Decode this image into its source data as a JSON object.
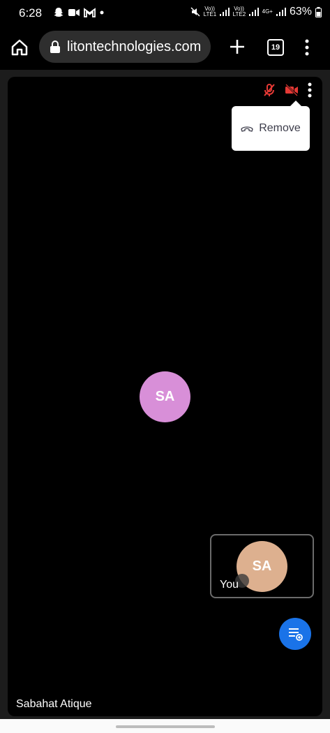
{
  "status_bar": {
    "time": "6:28",
    "battery": "63%",
    "left_icons": [
      "snapchat-icon",
      "video-icon",
      "gmail-icon",
      "dot-icon"
    ],
    "right_icons": [
      "mute-icon",
      "volte1-signal-icon",
      "volte2-signal-icon",
      "4g-icon",
      "battery-icon"
    ],
    "sim1_label": "Vo)) LTE1",
    "sim2_label": "Vo)) LTE2",
    "network": "4G+"
  },
  "browser": {
    "url": "litontechnologies.com",
    "tab_count": "19",
    "icons": [
      "home-icon",
      "lock-icon",
      "plus-icon",
      "tabs-icon",
      "more-vert-icon"
    ]
  },
  "meeting": {
    "controls": {
      "mic_icon": "mic-off-icon",
      "camera_icon": "video-off-icon",
      "menu_icon": "more-vert-icon",
      "muted_color": "#e53935"
    },
    "popup": {
      "icon": "phone-hangup-icon",
      "remove_label": "Remove"
    },
    "main_participant": {
      "initials": "SA",
      "name": "Sabahat Atique",
      "avatar_color": "#d88fd8"
    },
    "self_view": {
      "initials": "SA",
      "label": "You",
      "avatar_color": "#ddb08f"
    },
    "fab": {
      "icon": "participants-list-icon",
      "color": "#1a73e8"
    }
  }
}
